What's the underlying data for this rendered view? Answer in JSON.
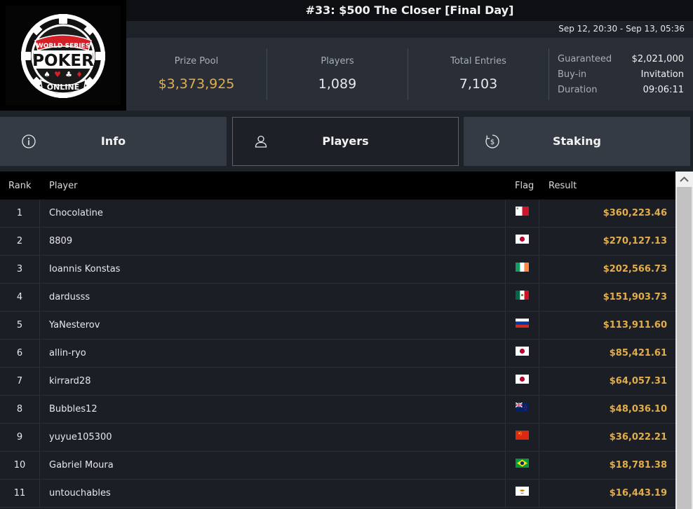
{
  "header": {
    "logo_alt": "WORLD SERIES POKER ONLINE",
    "title": "#33: $500 The Closer [Final Day]",
    "date_range": "Sep 12, 20:30 - Sep 13, 05:36"
  },
  "stats": {
    "prize_pool": {
      "label": "Prize Pool",
      "value": "$3,373,925"
    },
    "players": {
      "label": "Players",
      "value": "1,089"
    },
    "total_entries": {
      "label": "Total Entries",
      "value": "7,103"
    }
  },
  "info": {
    "guaranteed": {
      "label": "Guaranteed",
      "value": "$2,021,000"
    },
    "buyin": {
      "label": "Buy-in",
      "value": "Invitation"
    },
    "duration": {
      "label": "Duration",
      "value": "09:06:11"
    }
  },
  "tabs": [
    {
      "label": "Info",
      "icon": "info-circle-icon"
    },
    {
      "label": "Players",
      "icon": "user-icon",
      "active": true
    },
    {
      "label": "Staking",
      "icon": "dollar-circle-icon"
    }
  ],
  "table": {
    "columns": {
      "rank": "Rank",
      "player": "Player",
      "flag": "Flag",
      "result": "Result"
    },
    "rows": [
      {
        "rank": "1",
        "player": "Chocolatine",
        "flag": "malta-flag",
        "result": "$360,223.46"
      },
      {
        "rank": "2",
        "player": "8809",
        "flag": "japan-flag",
        "result": "$270,127.13"
      },
      {
        "rank": "3",
        "player": "Ioannis Konstas",
        "flag": "ireland-flag",
        "result": "$202,566.73"
      },
      {
        "rank": "4",
        "player": "dardusss",
        "flag": "mexico-flag",
        "result": "$151,903.73"
      },
      {
        "rank": "5",
        "player": "YaNesterov",
        "flag": "russia-flag",
        "result": "$113,911.60"
      },
      {
        "rank": "6",
        "player": "allin-ryo",
        "flag": "japan-flag",
        "result": "$85,421.61"
      },
      {
        "rank": "7",
        "player": "kirrard28",
        "flag": "japan-flag",
        "result": "$64,057.31"
      },
      {
        "rank": "8",
        "player": "Bubbles12",
        "flag": "new-zealand-flag",
        "result": "$48,036.10"
      },
      {
        "rank": "9",
        "player": "yuyue105300",
        "flag": "china-flag",
        "result": "$36,022.21"
      },
      {
        "rank": "10",
        "player": "Gabriel Moura",
        "flag": "brazil-flag",
        "result": "$18,781.38"
      },
      {
        "rank": "11",
        "player": "untouchables",
        "flag": "cyprus-flag",
        "result": "$16,443.19"
      }
    ]
  },
  "colors": {
    "accent_gold": "#e3ad4b",
    "header_bg": "#2a2f37",
    "table_bg": "#1b1f25"
  }
}
